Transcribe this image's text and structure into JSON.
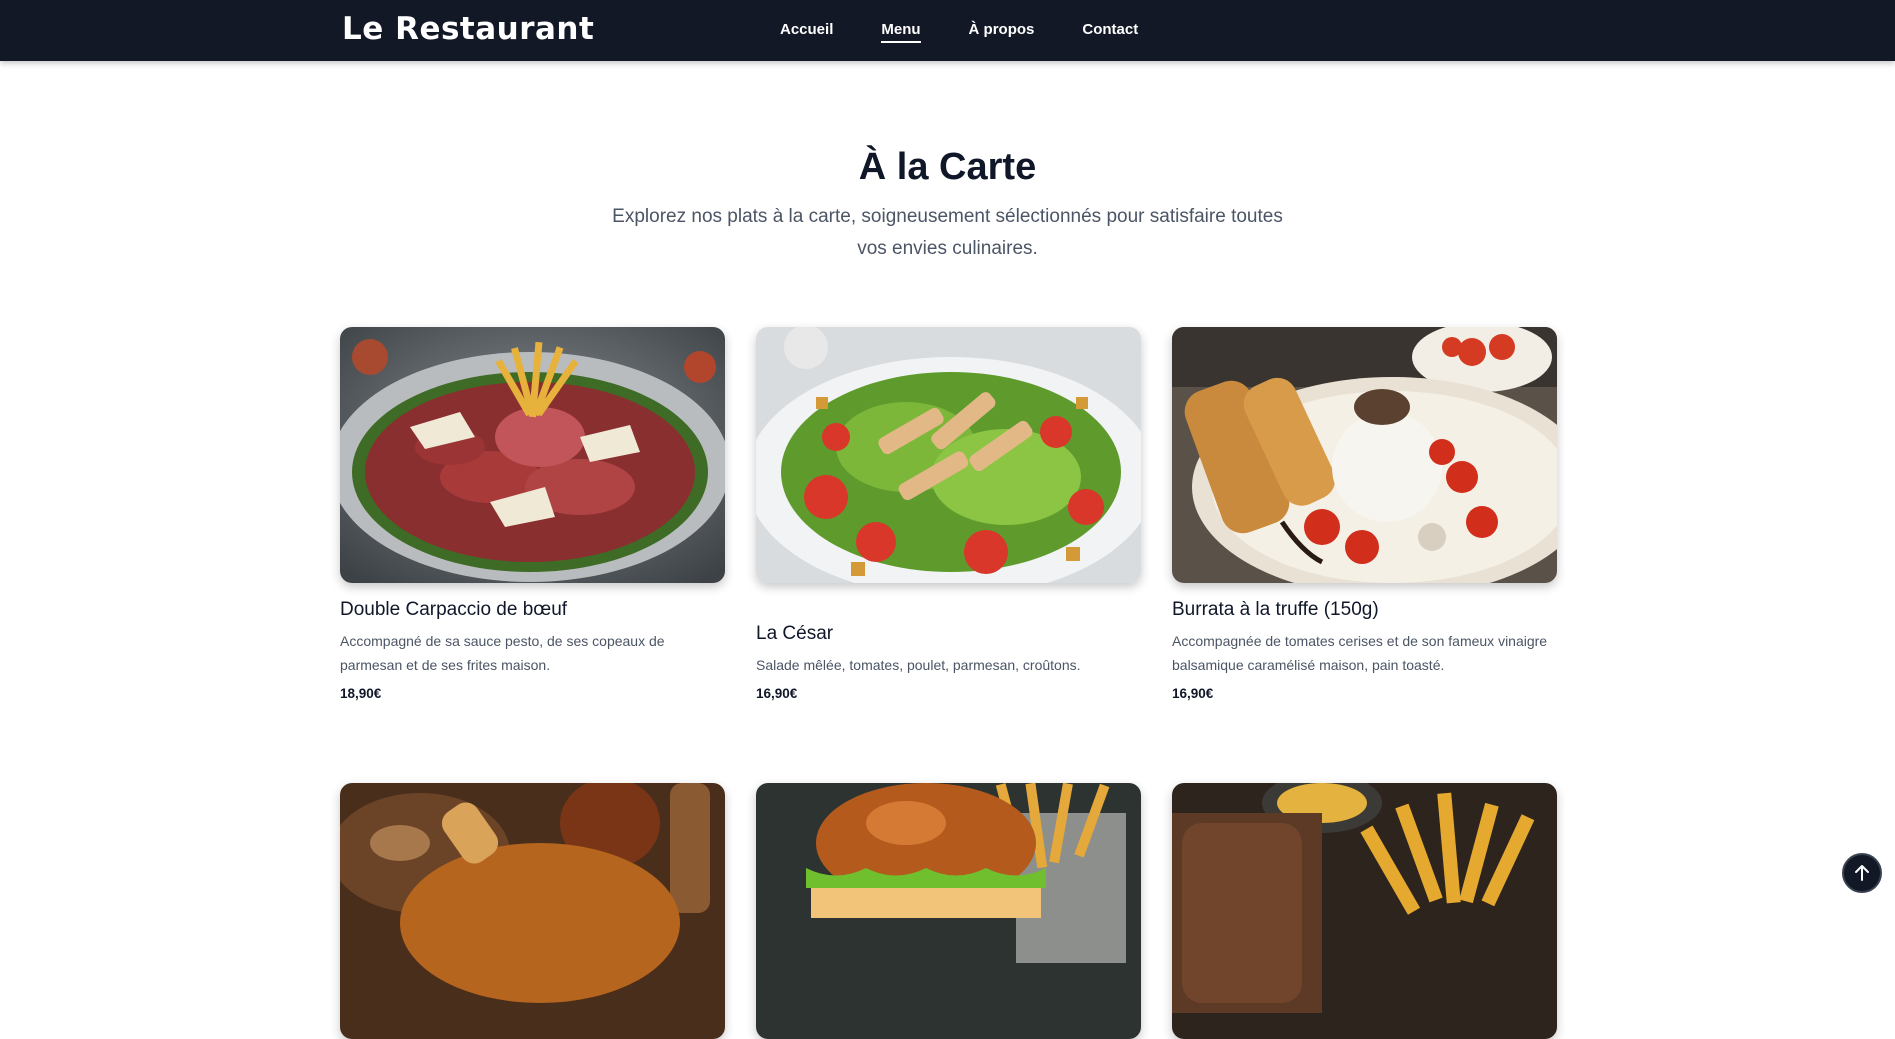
{
  "brand": "Le Restaurant",
  "nav": [
    {
      "label": "Accueil"
    },
    {
      "label": "Menu"
    },
    {
      "label": "À propos"
    },
    {
      "label": "Contact"
    }
  ],
  "section": {
    "title": "À la Carte",
    "subtitle": "Explorez nos plats à la carte, soigneusement sélectionnés pour satisfaire toutes vos envies culinaires."
  },
  "dishes": [
    {
      "name": "Double Carpaccio de bœuf",
      "description": "Accompagné de sa sauce pesto, de ses copeaux de parmesan et de ses frites maison.",
      "price": "18,90€"
    },
    {
      "name": "La César",
      "description": "Salade mêlée, tomates, poulet, parmesan, croûtons.",
      "price": "16,90€"
    },
    {
      "name": "Burrata à la truffe (150g)",
      "description": "Accompagnée de tomates cerises et de son fameux vinaigre balsamique caramélisé maison, pain toasté.",
      "price": "16,90€"
    }
  ],
  "colors": {
    "header_bg": "#121826",
    "text_primary": "#0f1729",
    "text_muted": "#4b5565"
  },
  "icons": {
    "scroll_top": "arrow-up-icon"
  }
}
